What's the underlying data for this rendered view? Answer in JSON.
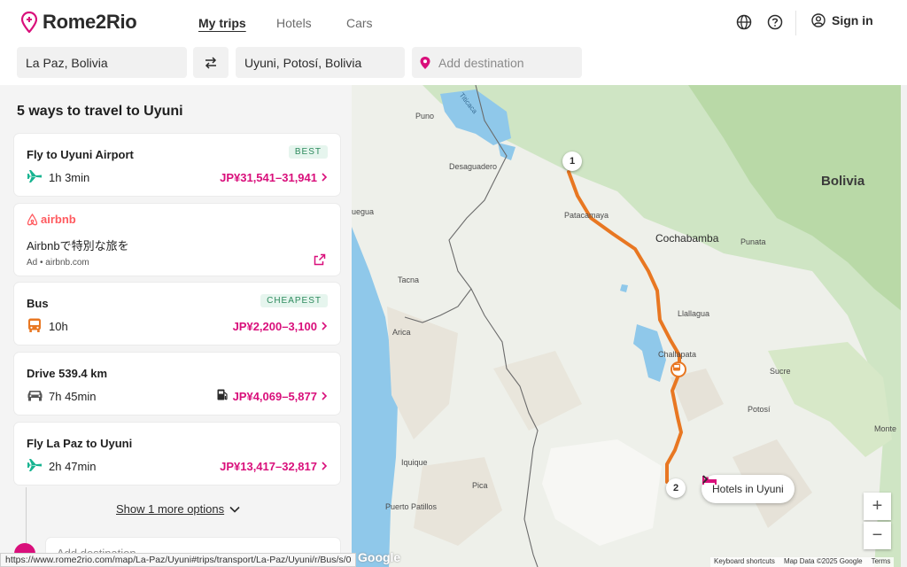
{
  "header": {
    "logo_text": "Rome2Rio",
    "nav": [
      "My trips",
      "Hotels",
      "Cars"
    ],
    "signin": "Sign in"
  },
  "search": {
    "origin": "La Paz, Bolivia",
    "destination": "Uyuni, Potosí, Bolivia",
    "add_destination_placeholder": "Add destination"
  },
  "panel": {
    "title": "5 ways to travel to Uyuni",
    "cards": [
      {
        "title": "Fly to Uyuni Airport",
        "badge": "BEST",
        "duration": "1h 3min",
        "price": "JP¥31,541–31,941",
        "icon": "plane-icon"
      },
      {
        "title": "Bus",
        "badge": "CHEAPEST",
        "duration": "10h",
        "price": "JP¥2,200–3,100",
        "icon": "bus-icon"
      },
      {
        "title": "Drive 539.4 km",
        "duration": "7h 45min",
        "price": "JP¥4,069–5,877",
        "icon": "car-icon"
      },
      {
        "title": "Fly La Paz to Uyuni",
        "duration": "2h 47min",
        "price": "JP¥13,417–32,817",
        "icon": "plane-icon"
      }
    ],
    "ad": {
      "brand": "airbnb",
      "text": "Airbnbで特別な旅を",
      "source": "Ad • airbnb.com"
    },
    "show_more": "Show 1 more options",
    "add_destination": "Add destination"
  },
  "status_url": "https://www.rome2rio.com/map/La-Paz/Uyuni#trips/transport/La-Paz/Uyuni/r/Bus/s/0",
  "map": {
    "labels": {
      "titicaca": "Titicaca",
      "puno": "Puno",
      "desaguadero": "Desaguadero",
      "uegua": "uegua",
      "patacamaya": "Patacamaya",
      "cochabamba": "Cochabamba",
      "punata": "Punata",
      "bolivia": "Bolivia",
      "tacna": "Tacna",
      "arica": "Arica",
      "llallagua": "Llallagua",
      "challapata": "Challapata",
      "sucre": "Sucre",
      "potosi": "Potosí",
      "monte": "Monte",
      "iquique": "Iquique",
      "pica": "Pica",
      "puerto_patillos": "Puerto Patillos"
    },
    "marker_1": "1",
    "marker_2": "2",
    "hotels_chip": "Hotels in Uyuni",
    "zoom_in": "+",
    "zoom_out": "−",
    "google": "Google",
    "footer": [
      "Keyboard shortcuts",
      "Map Data ©2025 Google",
      "Terms"
    ],
    "route_color": "#e87722",
    "accent": "#d90f7b"
  }
}
